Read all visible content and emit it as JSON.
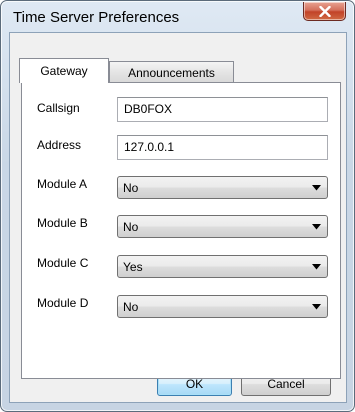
{
  "window": {
    "title": "Time Server Preferences"
  },
  "tabs": [
    {
      "label": "Gateway",
      "active": true
    },
    {
      "label": "Announcements",
      "active": false
    }
  ],
  "gateway": {
    "callsign": {
      "label": "Callsign",
      "value": "DB0FOX"
    },
    "address": {
      "label": "Address",
      "value": "127.0.0.1"
    },
    "modules": [
      {
        "label": "Module A",
        "value": "No"
      },
      {
        "label": "Module B",
        "value": "No"
      },
      {
        "label": "Module C",
        "value": "Yes"
      },
      {
        "label": "Module D",
        "value": "No"
      }
    ]
  },
  "buttons": {
    "ok": "OK",
    "cancel": "Cancel"
  },
  "icons": {
    "close": "close-icon",
    "dropdown": "chevron-down-icon"
  },
  "colors": {
    "close_button": "#c24328",
    "default_button_border": "#3c7fb1"
  }
}
